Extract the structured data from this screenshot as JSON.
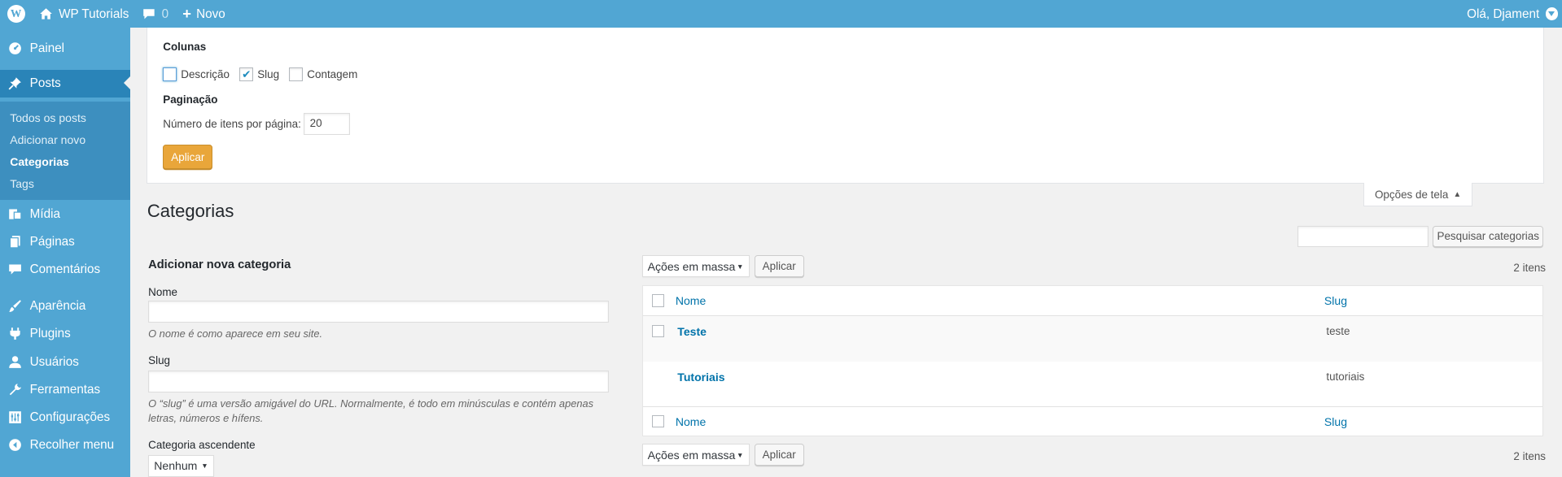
{
  "adminbar": {
    "site_name": "WP Tutorials",
    "comments_count": "0",
    "new_label": "Novo",
    "greeting": "Olá, Djament"
  },
  "sidebar": {
    "dashboard": "Painel",
    "posts": "Posts",
    "posts_submenu": [
      "Todos os posts",
      "Adicionar novo",
      "Categorias",
      "Tags"
    ],
    "media": "Mídia",
    "pages": "Páginas",
    "comments": "Comentários",
    "appearance": "Aparência",
    "plugins": "Plugins",
    "users": "Usuários",
    "tools": "Ferramentas",
    "settings": "Configurações",
    "collapse": "Recolher menu"
  },
  "screen_options": {
    "columns_heading": "Colunas",
    "columns": [
      {
        "label": "Descrição",
        "checked": false
      },
      {
        "label": "Slug",
        "checked": true
      },
      {
        "label": "Contagem",
        "checked": false
      }
    ],
    "pagination_heading": "Paginação",
    "per_page_label": "Número de itens por página:",
    "per_page_value": "20",
    "apply_label": "Aplicar",
    "tab_label": "Opções de tela"
  },
  "page": {
    "title": "Categorias"
  },
  "add_form": {
    "heading": "Adicionar nova categoria",
    "name_label": "Nome",
    "name_value": "",
    "name_desc": "O nome é como aparece em seu site.",
    "slug_label": "Slug",
    "slug_value": "",
    "slug_desc": "O “slug” é uma versão amigável do URL. Normalmente, é todo em minúsculas e contém apenas letras, números e hífens.",
    "parent_label": "Categoria ascendente",
    "parent_value": "Nenhum"
  },
  "list": {
    "search_button": "Pesquisar categorias",
    "search_value": "",
    "bulk_actions": "Ações em massa",
    "apply_label": "Aplicar",
    "item_count": "2 itens",
    "col_name": "Nome",
    "col_slug": "Slug",
    "rows": [
      {
        "name": "Teste",
        "slug": "teste",
        "has_checkbox": true
      },
      {
        "name": "Tutoriais",
        "slug": "tutoriais",
        "has_checkbox": false
      }
    ]
  },
  "colors": {
    "adminbar": "#51a6d3",
    "sidebar": "#51a6d3",
    "sidebar_current": "#2a84b8",
    "primary_button": "#e9a63a",
    "link": "#0073aa"
  }
}
